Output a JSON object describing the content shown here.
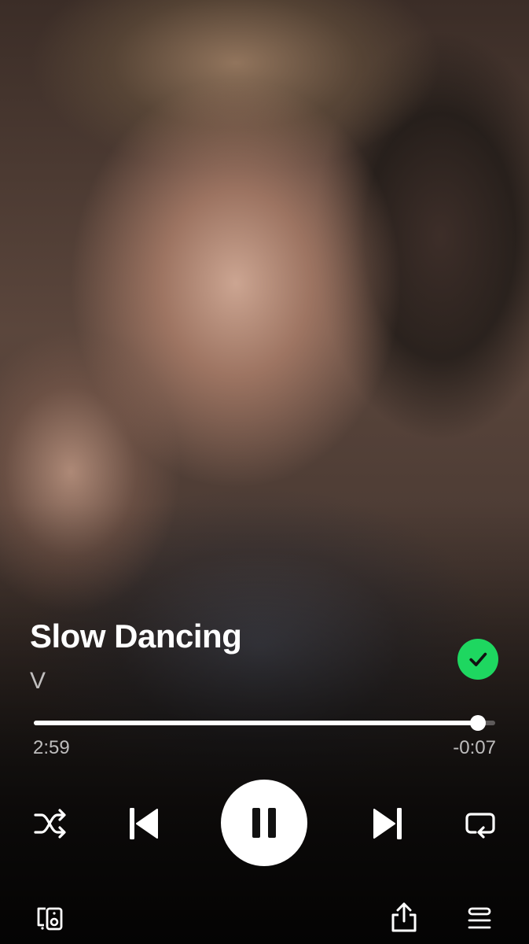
{
  "track": {
    "title": "Slow Dancing",
    "artist": "V",
    "liked": true
  },
  "playback": {
    "elapsed": "2:59",
    "remaining": "-0:07",
    "progress_fraction": 0.962,
    "is_playing": true
  },
  "icons": {
    "liked": "check-circle-icon",
    "shuffle": "shuffle-icon",
    "previous": "skip-previous-icon",
    "play_pause": "pause-icon",
    "next": "skip-next-icon",
    "repeat": "repeat-icon",
    "devices": "connect-devices-icon",
    "share": "share-icon",
    "queue": "queue-icon"
  },
  "colors": {
    "accent": "#1ed760",
    "text_primary": "#ffffff",
    "text_secondary": "rgba(255,255,255,0.72)"
  }
}
